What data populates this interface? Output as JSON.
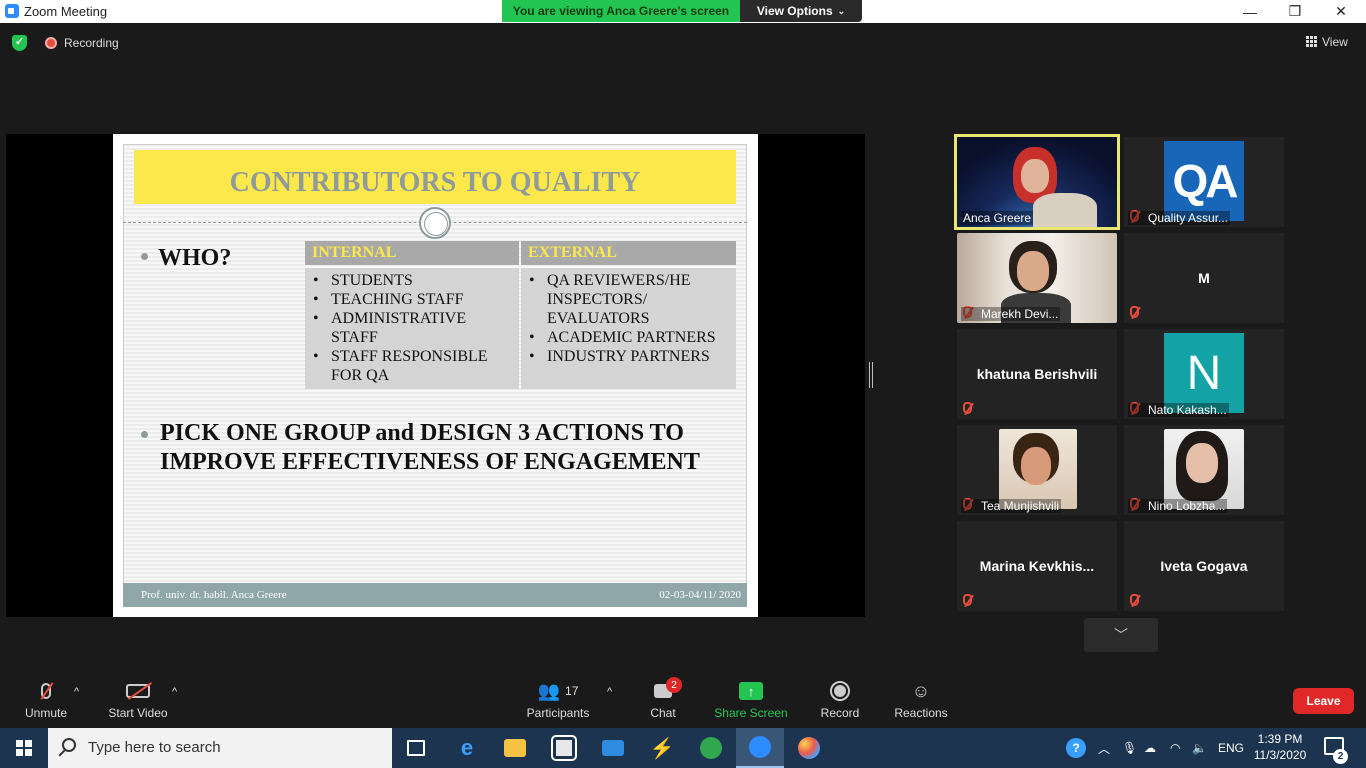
{
  "window": {
    "title": "Zoom Meeting",
    "viewing_banner": "You are viewing Anca Greere's screen",
    "view_options": "View Options",
    "minimize": "—",
    "maximize": "❐",
    "close": "✕"
  },
  "header": {
    "recording": "Recording",
    "view": "View"
  },
  "slide": {
    "title": "CONTRIBUTORS TO QUALITY",
    "who": "WHO?",
    "table": {
      "internal_header": "INTERNAL",
      "external_header": "EXTERNAL",
      "internal": [
        "STUDENTS",
        "TEACHING STAFF",
        "ADMINISTRATIVE STAFF",
        "STAFF RESPONSIBLE FOR QA"
      ],
      "external": [
        "QA REVIEWERS/HE INSPECTORS/ EVALUATORS",
        "ACADEMIC PARTNERS",
        "INDUSTRY PARTNERS"
      ]
    },
    "pick": "PICK ONE GROUP and DESIGN 3 ACTIONS TO IMPROVE EFFECTIVENESS OF ENGAGEMENT",
    "footer_left": "Prof. univ. dr. habil. Anca Greere",
    "footer_right": "02-03-04/11/ 2020"
  },
  "participants": [
    {
      "name": "Anca Greere"
    },
    {
      "name": "Quality Assur...",
      "logo": "QA"
    },
    {
      "name": "Marekh Devi..."
    },
    {
      "name": "M"
    },
    {
      "name": "khatuna Berishvili"
    },
    {
      "name": "Nato Kakash...",
      "logo": "N"
    },
    {
      "name": "Tea Munjishvili"
    },
    {
      "name": "Nino Lobzha..."
    },
    {
      "name": "Marina  Kevkhis..."
    },
    {
      "name": "Iveta Gogava"
    }
  ],
  "toolbar": {
    "unmute": "Unmute",
    "start_video": "Start Video",
    "participants": "Participants",
    "participants_count": "17",
    "chat": "Chat",
    "chat_badge": "2",
    "share_screen": "Share Screen",
    "record": "Record",
    "reactions": "Reactions",
    "leave": "Leave"
  },
  "taskbar": {
    "search_placeholder": "Type here to search",
    "language": "ENG",
    "time": "1:39 PM",
    "date": "11/3/2020",
    "notifications": "2"
  }
}
